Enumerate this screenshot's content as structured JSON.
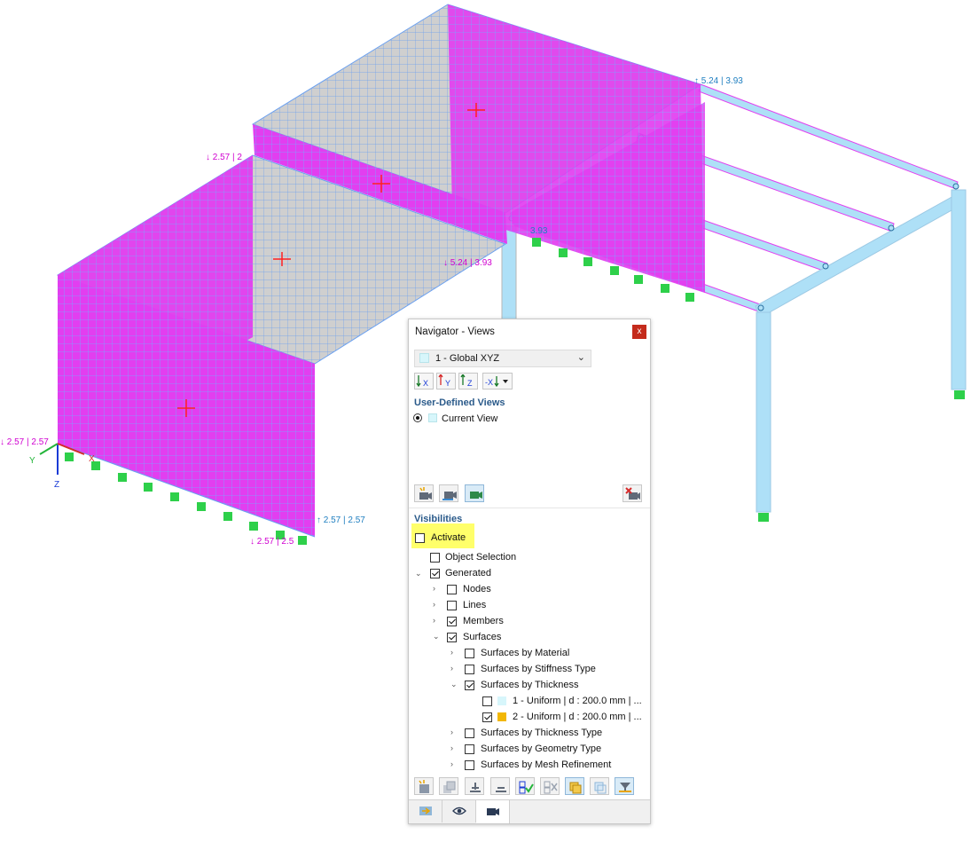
{
  "model": {
    "labels": [
      {
        "id": "top-left",
        "text": "↓ 2.57 | 2"
      },
      {
        "id": "mid",
        "text": "↓ 5.24 | 3.93"
      },
      {
        "id": "mid2",
        "text": "3.93"
      },
      {
        "id": "top-right",
        "text": "↑ 5.24 | 3.93"
      },
      {
        "id": "left",
        "text": "↓ 2.57 | 2.57"
      },
      {
        "id": "bottom-right",
        "text": "↑ 2.57 | 2.57"
      },
      {
        "id": "bottom",
        "text": "↓ 2.57 | 2.5"
      }
    ],
    "axes": {
      "x": "X",
      "y": "Y",
      "z": "Z"
    },
    "colors": {
      "surface_magenta": "#e23ef0",
      "mesh_grid": "#6aa9ff",
      "slab_grey": "#cfcfcf",
      "member_blue": "#aee0f7",
      "support_green": "#2ed04a"
    }
  },
  "navigator": {
    "title": "Navigator - Views",
    "close_label": "x",
    "view_selector": {
      "value": "1 - Global XYZ",
      "swatch_color": "#d7f6fb"
    },
    "axis_buttons": [
      {
        "name": "view-x-button",
        "label": "X"
      },
      {
        "name": "view-y-button",
        "label": "Y"
      },
      {
        "name": "view-z-button",
        "label": "Z"
      },
      {
        "name": "view-iso-button",
        "label": "-X"
      }
    ],
    "user_defined_views": {
      "heading": "User-Defined Views",
      "items": [
        {
          "label": "Current View",
          "selected": true
        }
      ]
    },
    "visibilities": {
      "heading": "Visibilities",
      "activate_label": "Activate",
      "activate_checked": false,
      "tree": [
        {
          "label": "Object Selection",
          "checked": false
        },
        {
          "label": "Generated",
          "checked": true,
          "expanded": true
        },
        {
          "label": "Nodes",
          "checked": false
        },
        {
          "label": "Lines",
          "checked": false
        },
        {
          "label": "Members",
          "checked": true
        },
        {
          "label": "Surfaces",
          "checked": true,
          "expanded": true
        },
        {
          "label": "Surfaces by Material",
          "checked": false
        },
        {
          "label": "Surfaces by Stiffness Type",
          "checked": false
        },
        {
          "label": "Surfaces by Thickness",
          "checked": true,
          "expanded": true
        },
        {
          "label": "1 - Uniform | d : 200.0 mm | ...",
          "checked": false,
          "swatch": "#d7f6fb"
        },
        {
          "label": "2 - Uniform | d : 200.0 mm | ...",
          "checked": true,
          "swatch": "#f2b705"
        },
        {
          "label": "Surfaces by Thickness Type",
          "checked": false
        },
        {
          "label": "Surfaces by Geometry Type",
          "checked": false
        },
        {
          "label": "Surfaces by Mesh Refinement",
          "checked": false
        }
      ]
    }
  }
}
